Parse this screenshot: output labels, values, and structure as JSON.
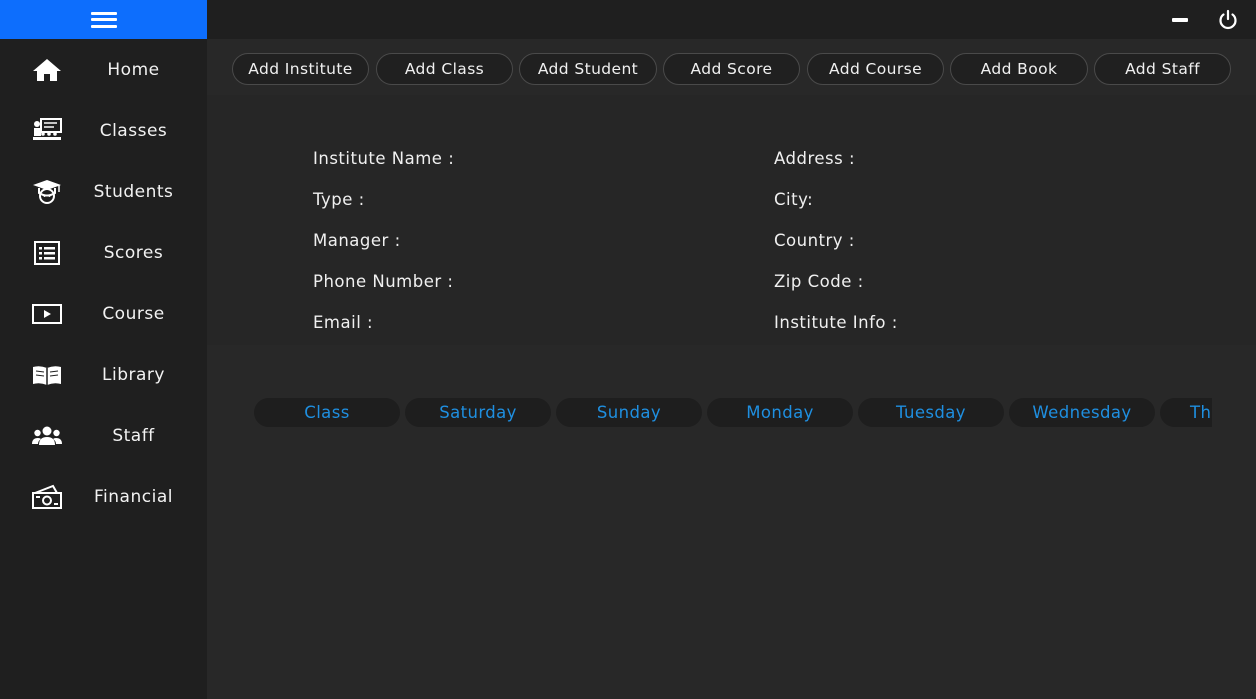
{
  "sidebar": {
    "menu_icon": "hamburger-icon",
    "items": [
      {
        "label": "Home",
        "icon": "home-icon"
      },
      {
        "label": "Classes",
        "icon": "classroom-icon"
      },
      {
        "label": "Students",
        "icon": "graduate-icon"
      },
      {
        "label": "Scores",
        "icon": "list-icon"
      },
      {
        "label": "Course",
        "icon": "video-play-icon"
      },
      {
        "label": "Library",
        "icon": "book-icon"
      },
      {
        "label": "Staff",
        "icon": "people-icon"
      },
      {
        "label": "Financial",
        "icon": "money-icon"
      }
    ]
  },
  "window_controls": {
    "minimize_icon": "minimize-icon",
    "power_icon": "power-icon"
  },
  "actions": [
    "Add Institute",
    "Add Class",
    "Add Student",
    "Add Score",
    "Add Course",
    "Add Book",
    "Add Staff"
  ],
  "info": {
    "left": [
      "Institute Name :",
      "Type :",
      "Manager :",
      "Phone Number :",
      "Email :"
    ],
    "right": [
      "Address :",
      "City:",
      "Country :",
      "Zip Code :",
      "Institute Info :"
    ]
  },
  "schedule": {
    "headers": [
      "Class",
      "Saturday",
      "Sunday",
      "Monday",
      "Tuesday",
      "Wednesday",
      "Th"
    ]
  },
  "colors": {
    "accent": "#0d6efd",
    "sidebar_bg": "#1f1f1f",
    "content_bg": "#282828",
    "schedule_text": "#1f8fe0"
  }
}
